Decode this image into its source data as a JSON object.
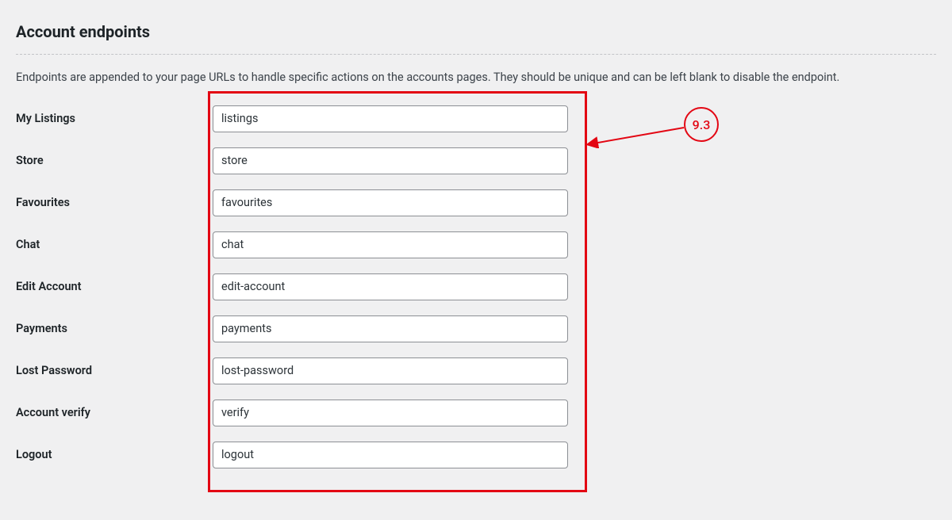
{
  "section": {
    "title": "Account endpoints",
    "description": "Endpoints are appended to your page URLs to handle specific actions on the accounts pages. They should be unique and can be left blank to disable the endpoint."
  },
  "rows": [
    {
      "label": "My Listings",
      "value": "listings"
    },
    {
      "label": "Store",
      "value": "store"
    },
    {
      "label": "Favourites",
      "value": "favourites"
    },
    {
      "label": "Chat",
      "value": "chat"
    },
    {
      "label": "Edit Account",
      "value": "edit-account"
    },
    {
      "label": "Payments",
      "value": "payments"
    },
    {
      "label": "Lost Password",
      "value": "lost-password"
    },
    {
      "label": "Account verify",
      "value": "verify"
    },
    {
      "label": "Logout",
      "value": "logout"
    }
  ],
  "annotation": {
    "label": "9.3"
  }
}
